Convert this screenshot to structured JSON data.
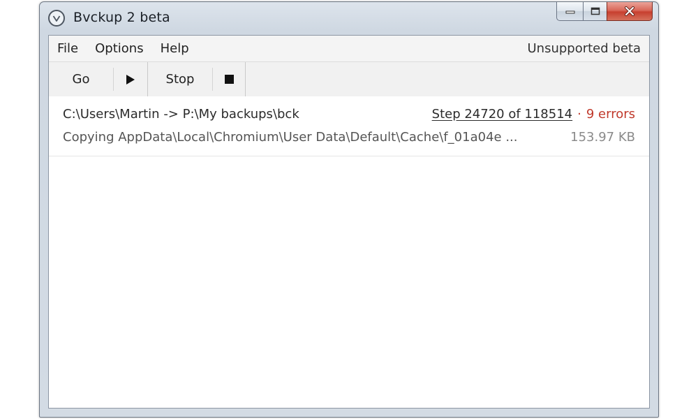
{
  "window": {
    "title": "Bvckup 2 beta",
    "caption_buttons": [
      "minimize",
      "maximize",
      "close"
    ]
  },
  "menu": {
    "items": [
      "File",
      "Options",
      "Help"
    ],
    "right_label": "Unsupported beta"
  },
  "toolbar": {
    "go_label": "Go",
    "stop_label": "Stop"
  },
  "job": {
    "path": "C:\\Users\\Martin -> P:\\My backups\\bck",
    "step": "Step 24720 of 118514",
    "separator": "·",
    "errors": "9 errors",
    "status": "Copying AppData\\Local\\Chromium\\User Data\\Default\\Cache\\f_01a04e ...",
    "size": "153.97 KB"
  },
  "colors": {
    "error_red": "#c0392b",
    "close_button_red": "#c7402f"
  },
  "icons": {
    "app": "bvckup-logo-icon",
    "go": "play-icon",
    "stop": "stop-icon"
  }
}
